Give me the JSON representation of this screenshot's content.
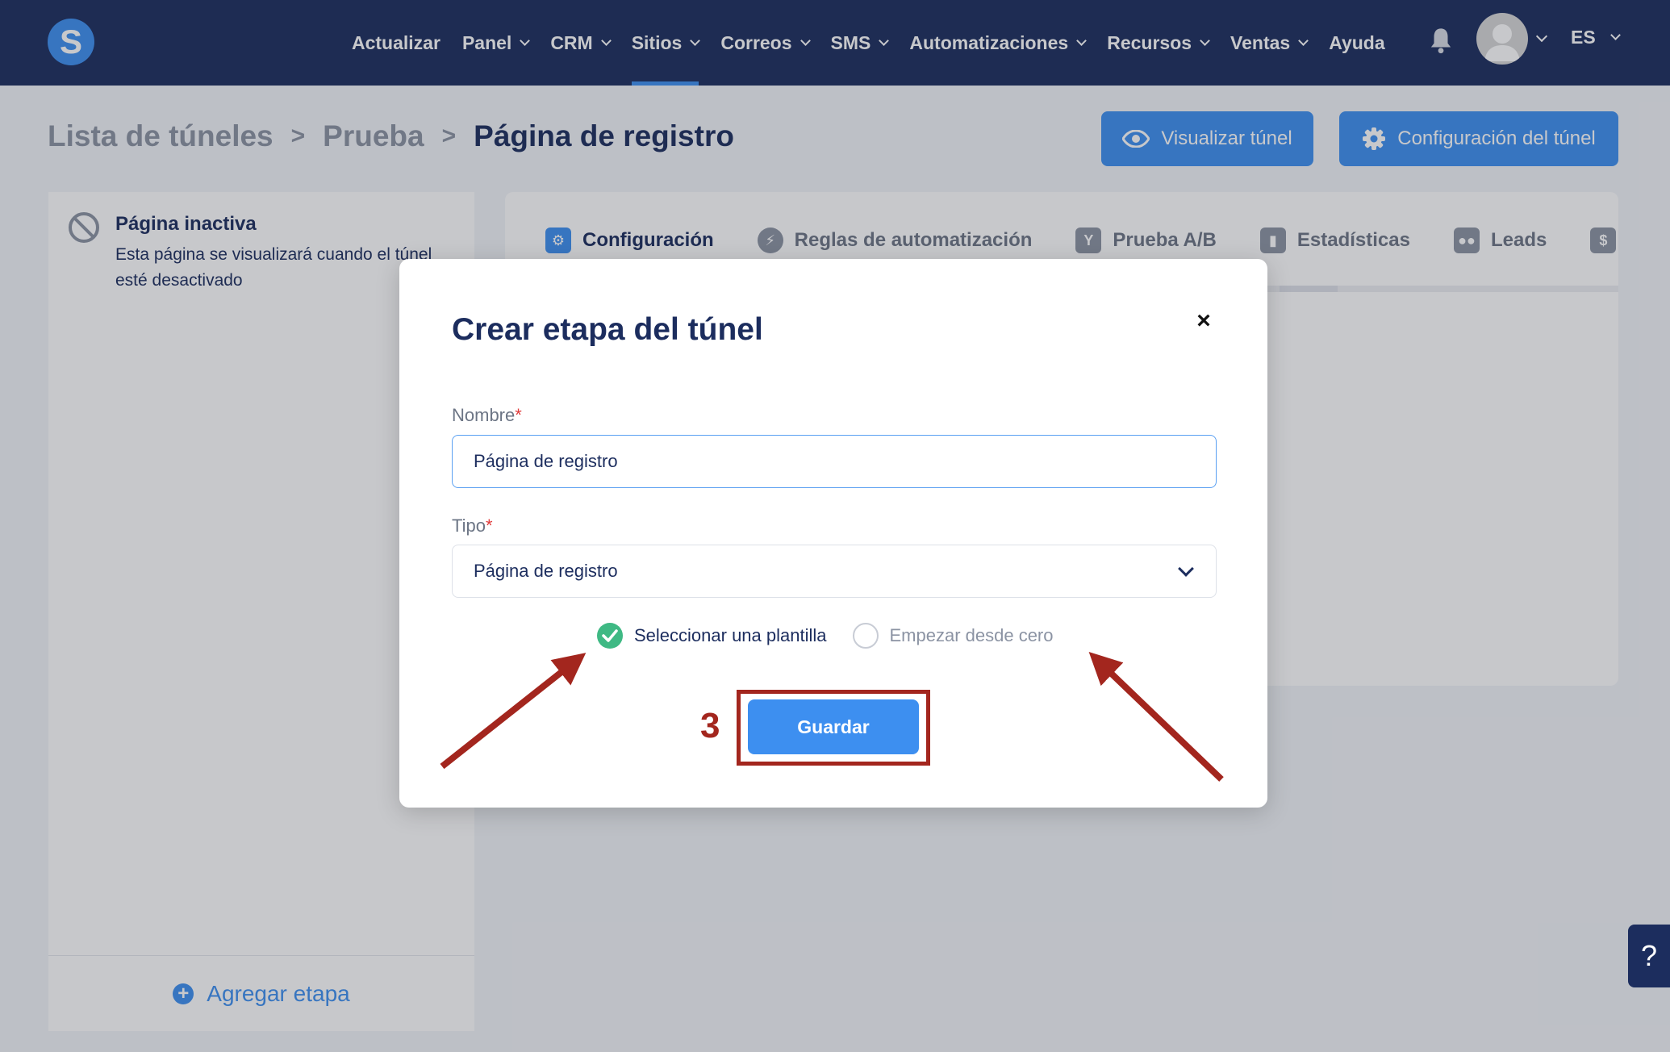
{
  "app": {
    "logo_letter": "S"
  },
  "nav": {
    "items": [
      {
        "label": "Actualizar",
        "dropdown": false,
        "active": false
      },
      {
        "label": "Panel",
        "dropdown": true,
        "active": false
      },
      {
        "label": "CRM",
        "dropdown": true,
        "active": false
      },
      {
        "label": "Sitios",
        "dropdown": true,
        "active": true
      },
      {
        "label": "Correos",
        "dropdown": true,
        "active": false
      },
      {
        "label": "SMS",
        "dropdown": true,
        "active": false
      },
      {
        "label": "Automatizaciones",
        "dropdown": true,
        "active": false
      },
      {
        "label": "Recursos",
        "dropdown": true,
        "active": false
      },
      {
        "label": "Ventas",
        "dropdown": true,
        "active": false
      },
      {
        "label": "Ayuda",
        "dropdown": false,
        "active": false
      }
    ],
    "language": "ES"
  },
  "breadcrumb": {
    "items": [
      "Lista de túneles",
      "Prueba"
    ],
    "current": "Página de registro",
    "separator": ">"
  },
  "header_buttons": {
    "visualizar": "Visualizar túnel",
    "configuracion": "Configuración del túnel"
  },
  "sidebar": {
    "inactive_title": "Página inactiva",
    "inactive_description": "Esta página se visualizará cuando el túnel esté desactivado",
    "add_step": "Agregar etapa"
  },
  "tabs": [
    {
      "label": "Configuración",
      "icon": "sliders-icon",
      "active": true
    },
    {
      "label": "Reglas de automatización",
      "icon": "bolt-icon",
      "active": false
    },
    {
      "label": "Prueba A/B",
      "icon": "split-icon",
      "active": false
    },
    {
      "label": "Estadísticas",
      "icon": "bar-chart-icon",
      "active": false
    },
    {
      "label": "Leads",
      "icon": "users-icon",
      "active": false
    },
    {
      "label": "$",
      "icon": "dollar-icon",
      "active": false
    }
  ],
  "modal": {
    "title": "Crear etapa del túnel",
    "close_symbol": "×",
    "nombre_label": "Nombre",
    "nombre_value": "Página de registro",
    "tipo_label": "Tipo",
    "tipo_value": "Página de registro",
    "required_mark": "*",
    "option_template": "Seleccionar una plantilla",
    "option_scratch": "Empezar desde cero",
    "selected_option": "template",
    "save_label": "Guardar"
  },
  "annotation": {
    "step_number": "3",
    "color": "#a3261e"
  },
  "help_tab": {
    "label": "?"
  },
  "colors": {
    "navy": "#1c2d5e",
    "accent": "#3d8ff0",
    "success": "#3fb984",
    "required": "#e03b3b"
  }
}
